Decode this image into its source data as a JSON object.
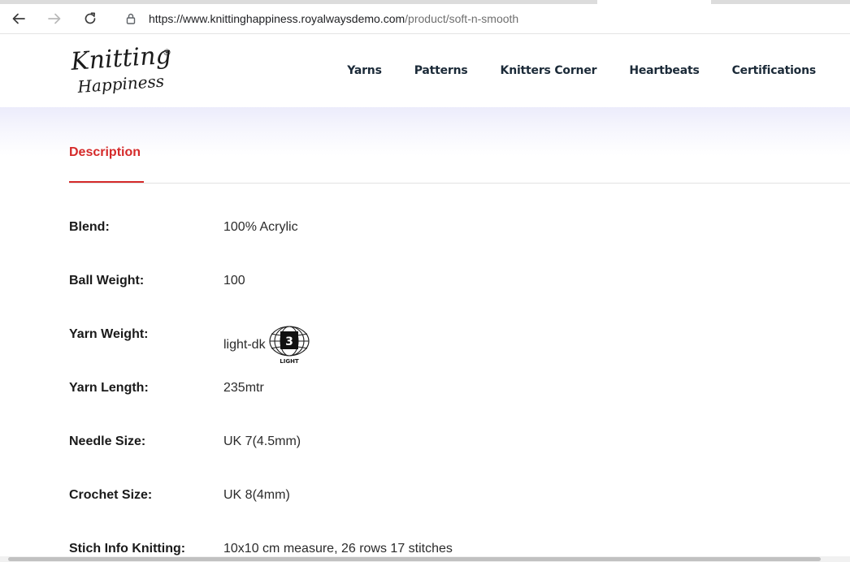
{
  "browser": {
    "url_host": "https://www.knittinghappiness.royalwaysdemo.com",
    "url_path": "/product/soft-n-smooth",
    "icons": [
      "back-arrow-icon",
      "forward-arrow-icon",
      "reload-icon",
      "lock-icon"
    ]
  },
  "header": {
    "logo_line1": "Knitting",
    "logo_line2": "Happiness",
    "logo_mark": "®",
    "nav": [
      "Yarns",
      "Patterns",
      "Knitters Corner",
      "Heartbeats",
      "Certifications"
    ]
  },
  "tabs": {
    "active": "Description"
  },
  "specs": [
    {
      "label": "Blend:",
      "value": "100% Acrylic"
    },
    {
      "label": "Ball Weight:",
      "value": "100"
    },
    {
      "label": "Yarn Weight:",
      "value": "light-dk",
      "icon_number": "3",
      "icon_text": "LIGHT"
    },
    {
      "label": "Yarn Length:",
      "value": "235mtr"
    },
    {
      "label": "Needle Size:",
      "value": "UK 7(4.5mm)"
    },
    {
      "label": "Crochet Size:",
      "value": "UK 8(4mm)"
    },
    {
      "label": "Stich Info Knitting:",
      "value": "10x10 cm measure, 26 rows 17 stitches"
    }
  ],
  "colors": {
    "accent": "#d52a2a",
    "nav_text": "#1b2a38",
    "label_text": "#1a1a1a"
  }
}
